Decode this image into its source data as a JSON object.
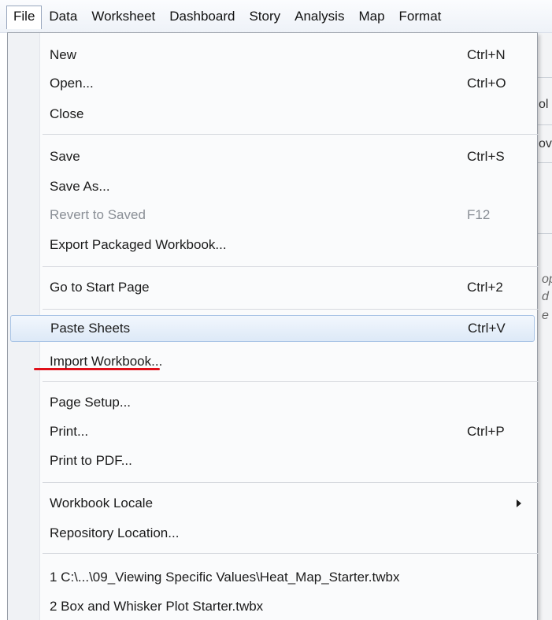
{
  "menubar": {
    "items": [
      {
        "label": "File",
        "active": true
      },
      {
        "label": "Data"
      },
      {
        "label": "Worksheet"
      },
      {
        "label": "Dashboard"
      },
      {
        "label": "Story"
      },
      {
        "label": "Analysis"
      },
      {
        "label": "Map"
      },
      {
        "label": "Format"
      }
    ]
  },
  "file_menu": {
    "items": [
      {
        "label": "New",
        "shortcut": "Ctrl+N"
      },
      {
        "label": "Open...",
        "shortcut": "Ctrl+O"
      },
      {
        "label": "Close",
        "shortcut": ""
      },
      {
        "label": "Save",
        "shortcut": "Ctrl+S"
      },
      {
        "label": "Save As...",
        "shortcut": ""
      },
      {
        "label": "Revert to Saved",
        "shortcut": "F12",
        "disabled": true
      },
      {
        "label": "Export Packaged Workbook...",
        "shortcut": ""
      },
      {
        "label": "Go to Start Page",
        "shortcut": "Ctrl+2"
      },
      {
        "label": "Paste Sheets",
        "shortcut": "Ctrl+V",
        "highlighted": true
      },
      {
        "label": "Import Workbook...",
        "shortcut": ""
      },
      {
        "label": "Page Setup...",
        "shortcut": ""
      },
      {
        "label": "Print...",
        "shortcut": "Ctrl+P"
      },
      {
        "label": "Print to PDF...",
        "shortcut": ""
      },
      {
        "label": "Workbook Locale",
        "shortcut": "",
        "submenu": true
      },
      {
        "label": "Repository Location...",
        "shortcut": ""
      },
      {
        "label": "1 C:\\...\\09_Viewing Specific Values\\Heat_Map_Starter.twbx",
        "shortcut": ""
      },
      {
        "label": "2 Box and Whisker Plot Starter.twbx",
        "shortcut": ""
      }
    ]
  },
  "background": {
    "fragments": [
      "ol",
      "ov",
      "op",
      "d",
      "e"
    ]
  },
  "colors": {
    "highlight_border": "#a9c4e6",
    "annotation_underline": "#e0101a",
    "disabled_text": "#8a8f96"
  }
}
